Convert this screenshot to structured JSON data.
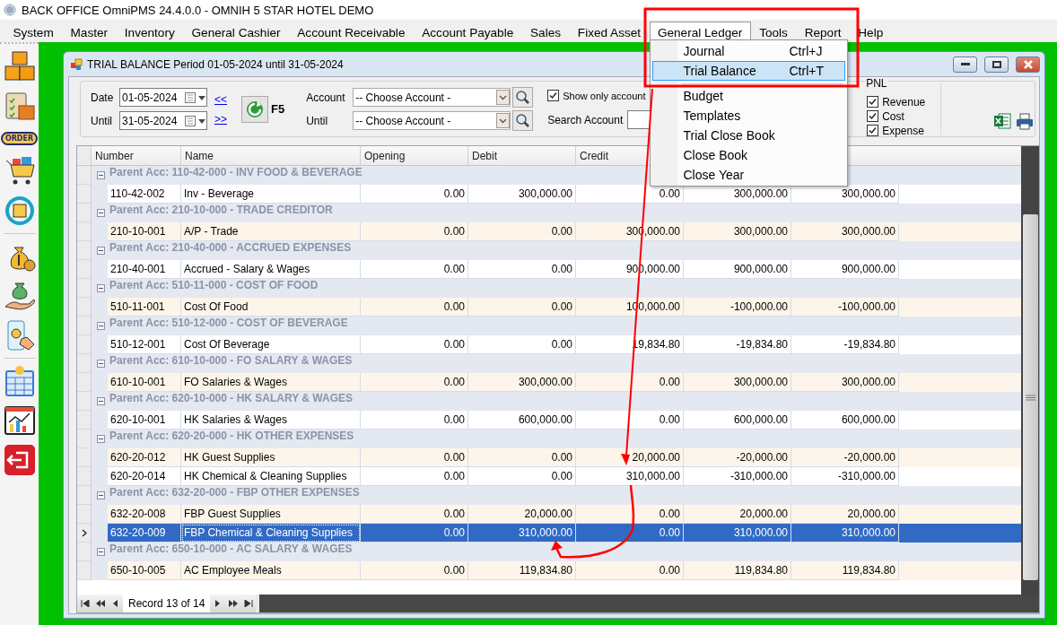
{
  "window": {
    "title": "BACK OFFICE OmniPMS 24.4.0.0 - OMNIH 5 STAR HOTEL DEMO"
  },
  "menu_bar": [
    {
      "label": "System",
      "selected": false
    },
    {
      "label": "Master",
      "selected": false
    },
    {
      "label": "Inventory",
      "selected": false
    },
    {
      "label": "General Cashier",
      "selected": false
    },
    {
      "label": "Account Receivable",
      "selected": false
    },
    {
      "label": "Account Payable",
      "selected": false
    },
    {
      "label": "Sales",
      "selected": false
    },
    {
      "label": "Fixed Asset",
      "selected": false
    },
    {
      "label": "General Ledger",
      "selected": true
    },
    {
      "label": "Tools",
      "selected": false
    },
    {
      "label": "Report",
      "selected": false
    },
    {
      "label": "Help",
      "selected": false
    }
  ],
  "open_menu": {
    "items": [
      {
        "kind": "item",
        "label": "Journal",
        "shortcut": "Ctrl+J",
        "selected": false
      },
      {
        "kind": "item",
        "label": "Trial Balance",
        "shortcut": "Ctrl+T",
        "selected": true
      },
      {
        "kind": "separator"
      },
      {
        "kind": "item",
        "label": "Budget",
        "selected": false
      },
      {
        "kind": "item",
        "label": "Templates",
        "selected": false
      },
      {
        "kind": "item",
        "label": "Trial Close Book",
        "selected": false
      },
      {
        "kind": "item",
        "label": "Close Book",
        "selected": false
      },
      {
        "kind": "item",
        "label": "Close Year",
        "selected": false
      }
    ]
  },
  "sidebar": {
    "order_badge": "ORDER"
  },
  "child_window": {
    "title": "TRIAL BALANCE Period  01-05-2024 until 31-05-2024"
  },
  "filters": {
    "date_label": "Date",
    "date": "01-05-2024",
    "until_label": "Until",
    "until_date": "31-05-2024",
    "prev_link": "<<",
    "next_link": ">>",
    "refresh_key": "F5",
    "account_label": "Account",
    "account_from": "-- Choose Account -",
    "account_until_label": "Until",
    "account_until": "-- Choose Account -",
    "show_only": {
      "label": "Show only account",
      "checked": true
    },
    "search_label": "Search Account",
    "pnl": {
      "title": "PNL",
      "options": [
        {
          "label": "Revenue",
          "checked": true
        },
        {
          "label": "Cost",
          "checked": true
        },
        {
          "label": "Expense",
          "checked": true
        }
      ]
    }
  },
  "grid": {
    "columns": [
      "Number",
      "Name",
      "Opening",
      "Debit",
      "Credit"
    ],
    "groups": [
      {
        "label": "Parent Acc: 110-42-000 - INV FOOD & BEVERAGE",
        "expanded": true,
        "rows": [
          {
            "cells": [
              "110-42-002",
              "Inv - Beverage",
              "0.00",
              "300,000.00",
              "0.00",
              "300,000.00",
              "300,000.00"
            ],
            "selected": false
          }
        ]
      },
      {
        "label": "Parent Acc: 210-10-000 - TRADE CREDITOR",
        "expanded": true,
        "rows": [
          {
            "cells": [
              "210-10-001",
              "A/P - Trade",
              "0.00",
              "0.00",
              "300,000.00",
              "300,000.00",
              "300,000.00"
            ],
            "selected": false
          }
        ]
      },
      {
        "label": "Parent Acc: 210-40-000 - ACCRUED EXPENSES",
        "expanded": true,
        "rows": [
          {
            "cells": [
              "210-40-001",
              "Accrued - Salary & Wages",
              "0.00",
              "0.00",
              "900,000.00",
              "900,000.00",
              "900,000.00"
            ],
            "selected": false
          }
        ]
      },
      {
        "label": "Parent Acc: 510-11-000 - COST OF FOOD",
        "expanded": true,
        "rows": [
          {
            "cells": [
              "510-11-001",
              "Cost Of Food",
              "0.00",
              "0.00",
              "100,000.00",
              "-100,000.00",
              "-100,000.00"
            ],
            "selected": false
          }
        ]
      },
      {
        "label": "Parent Acc: 510-12-000 - COST OF BEVERAGE",
        "expanded": true,
        "rows": [
          {
            "cells": [
              "510-12-001",
              "Cost Of Beverage",
              "0.00",
              "0.00",
              "19,834.80",
              "-19,834.80",
              "-19,834.80"
            ],
            "selected": false
          }
        ]
      },
      {
        "label": "Parent Acc: 610-10-000 - FO SALARY & WAGES",
        "expanded": true,
        "rows": [
          {
            "cells": [
              "610-10-001",
              "FO Salaries & Wages",
              "0.00",
              "300,000.00",
              "0.00",
              "300,000.00",
              "300,000.00"
            ],
            "selected": false
          }
        ]
      },
      {
        "label": "Parent Acc: 620-10-000 - HK SALARY & WAGES",
        "expanded": true,
        "rows": [
          {
            "cells": [
              "620-10-001",
              "HK Salaries & Wages",
              "0.00",
              "600,000.00",
              "0.00",
              "600,000.00",
              "600,000.00"
            ],
            "selected": false
          }
        ]
      },
      {
        "label": "Parent Acc: 620-20-000 - HK OTHER EXPENSES",
        "expanded": true,
        "rows": [
          {
            "cells": [
              "620-20-012",
              "HK Guest Supplies",
              "0.00",
              "0.00",
              "20,000.00",
              "-20,000.00",
              "-20,000.00"
            ],
            "selected": false
          },
          {
            "cells": [
              "620-20-014",
              "HK Chemical & Cleaning Supplies",
              "0.00",
              "0.00",
              "310,000.00",
              "-310,000.00",
              "-310,000.00"
            ],
            "selected": false
          }
        ]
      },
      {
        "label": "Parent Acc: 632-20-000 - FBP OTHER EXPENSES",
        "expanded": true,
        "rows": [
          {
            "cells": [
              "632-20-008",
              "FBP Guest Supplies",
              "0.00",
              "20,000.00",
              "0.00",
              "20,000.00",
              "20,000.00"
            ],
            "selected": false
          },
          {
            "cells": [
              "632-20-009",
              "FBP Chemical & Cleaning Supplies",
              "0.00",
              "310,000.00",
              "0.00",
              "310,000.00",
              "310,000.00"
            ],
            "selected": true
          }
        ]
      },
      {
        "label": "Parent Acc: 650-10-000 - AC SALARY & WAGES",
        "expanded": true,
        "rows": [
          {
            "cells": [
              "650-10-005",
              "AC Employee Meals",
              "0.00",
              "119,834.80",
              "0.00",
              "119,834.80",
              "119,834.80"
            ],
            "selected": false
          }
        ]
      }
    ]
  },
  "navigator": {
    "record": "Record 13 of 14"
  }
}
